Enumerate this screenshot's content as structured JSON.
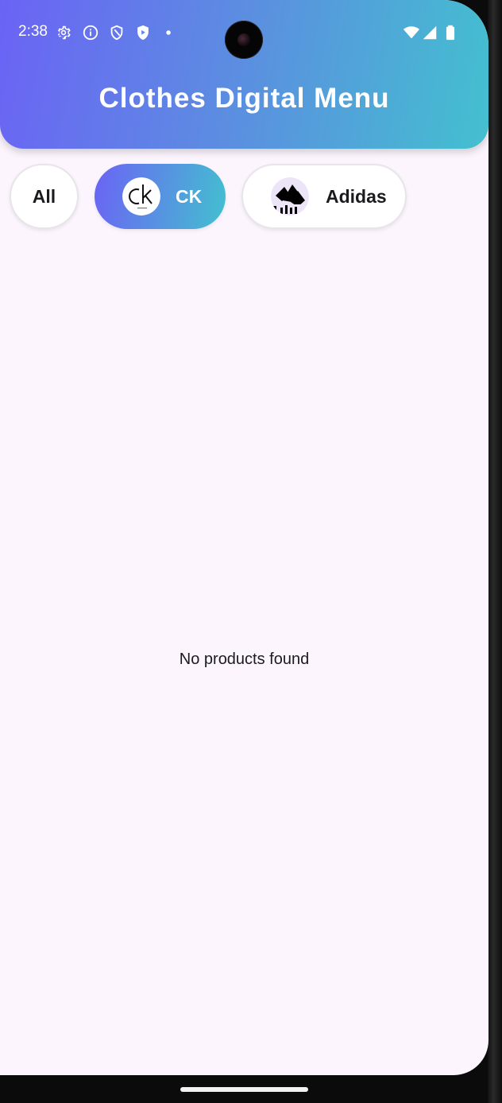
{
  "status_bar": {
    "time": "2:38",
    "left_icons": [
      "gear-icon",
      "info-icon",
      "shield-icon",
      "play-shield-icon",
      "dot-icon"
    ],
    "right_icons": [
      "wifi-icon",
      "signal-icon",
      "battery-icon"
    ]
  },
  "header": {
    "title": "Clothes Digital Menu"
  },
  "filters": {
    "all_label": "All",
    "ck_label": "CK",
    "adidas_label": "Adidas",
    "selected": "CK"
  },
  "main": {
    "empty_message": "No products found"
  },
  "colors": {
    "gradient_start": "#6b63f5",
    "gradient_end": "#43c0cf",
    "background": "#fcf5fd"
  }
}
